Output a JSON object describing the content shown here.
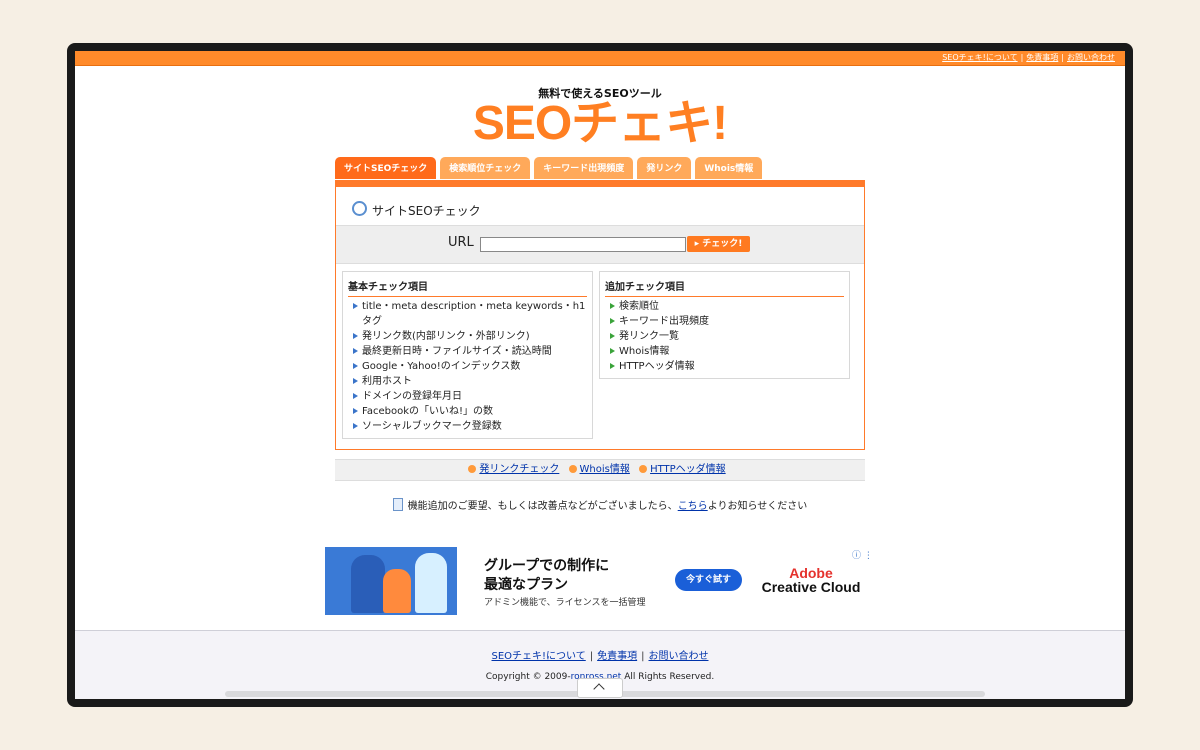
{
  "topbar": {
    "links": [
      "SEOチェキ!について",
      "免責事項",
      "お問い合わせ"
    ]
  },
  "header": {
    "tagline": "無料で使えるSEOツール",
    "logo": "SEOチェキ!"
  },
  "tabs": [
    "サイトSEOチェック",
    "検索順位チェック",
    "キーワード出現頻度",
    "発リンク",
    "Whois情報"
  ],
  "panel": {
    "title": "サイトSEOチェック",
    "url_label": "URL",
    "url_value": "",
    "check_button": "チェック!"
  },
  "basic": {
    "title": "基本チェック項目",
    "items": [
      "title・meta description・meta keywords・h1タグ",
      "発リンク数(内部リンク・外部リンク)",
      "最終更新日時・ファイルサイズ・読込時間",
      "Google・Yahoo!のインデックス数",
      "利用ホスト",
      "ドメインの登録年月日",
      "Facebookの「いいね!」の数",
      "ソーシャルブックマーク登録数"
    ]
  },
  "extra": {
    "title": "追加チェック項目",
    "items": [
      "検索順位",
      "キーワード出現頻度",
      "発リンク一覧",
      "Whois情報",
      "HTTPヘッダ情報"
    ]
  },
  "bottom_links": [
    "発リンクチェック",
    "Whois情報",
    "HTTPヘッダ情報"
  ],
  "notice": {
    "before": "機能追加のご要望、もしくは改善点などがございましたら、",
    "link": "こちら",
    "after": "よりお知らせください"
  },
  "ad": {
    "headline1": "グループでの制作に",
    "headline2": "最適なプラン",
    "sub": "アドミン機能で、ライセンスを一括管理",
    "cta": "今すぐ試す",
    "brand1": "Adobe",
    "brand2": "Creative Cloud",
    "info": "ⓘ ⋮"
  },
  "footer": {
    "links": [
      "SEOチェキ!について",
      "免責事項",
      "お問い合わせ"
    ],
    "copy_before": "Copyright © 2009-",
    "copy_link": "ronross.net",
    "copy_after": " All Rights Reserved."
  }
}
